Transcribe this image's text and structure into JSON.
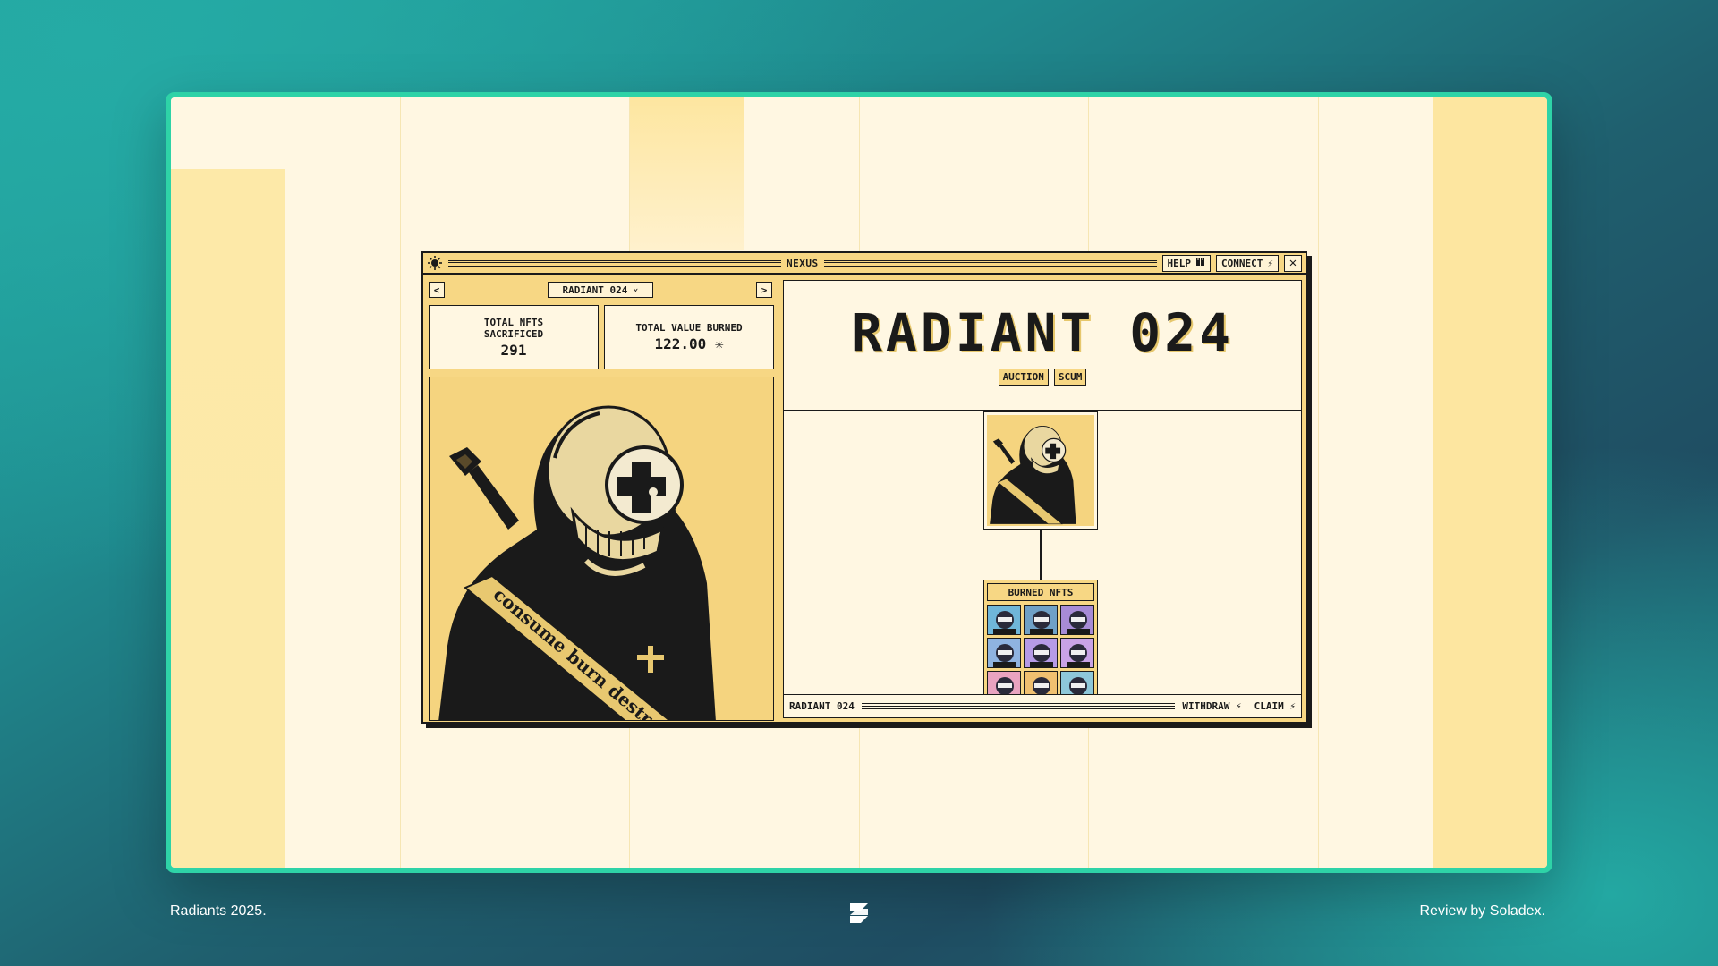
{
  "window": {
    "title": "NEXUS",
    "help_label": "HELP",
    "connect_label": "CONNECT",
    "connect_symbol": "⚡",
    "close_symbol": "✕"
  },
  "nav": {
    "prev_symbol": "<",
    "next_symbol": ">",
    "selected": "RADIANT 024",
    "chevron": "⌄"
  },
  "stats": {
    "nfts_label": "TOTAL NFTS\nSACRIFICED",
    "nfts_value": "291",
    "value_label": "TOTAL VALUE BURNED",
    "value_value": "122.00 ✳"
  },
  "hero": {
    "title": "RADIANT 024",
    "tags": [
      "AUCTION",
      "SCUM"
    ]
  },
  "artwork": {
    "sash_text": "consume burn destroy"
  },
  "burned": {
    "header": "BURNED NFTS",
    "tile_colors": [
      "#6fb6d9",
      "#6fa0c6",
      "#a78bd6",
      "#8fb3e0",
      "#b69be6",
      "#c9a3e6",
      "#e9a3c0",
      "#f0c070",
      "#8ec7d9"
    ]
  },
  "statusbar": {
    "name": "RADIANT 024",
    "withdraw_label": "WITHDRAW ⚡",
    "claim_label": "CLAIM ⚡"
  },
  "footer": {
    "left": "Radiants 2025.",
    "right": "Review by Soladex."
  },
  "colors": {
    "accent": "#2ed3a7",
    "panel": "#f7d784",
    "ink": "#1a1a1a"
  }
}
